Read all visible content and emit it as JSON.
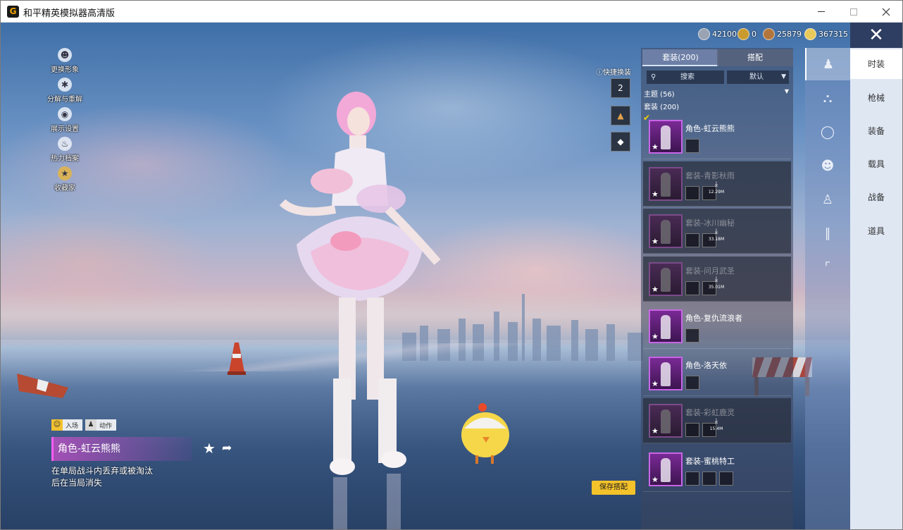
{
  "window": {
    "title": "和平精英模拟器高清版",
    "icon_letter": "G"
  },
  "currency": [
    {
      "icon": "silver-coin-icon",
      "value": "42100",
      "color": "#9aa3b3"
    },
    {
      "icon": "yellow-coupon-icon",
      "value": "0",
      "color": "#c99b2e"
    },
    {
      "icon": "bronze-coin-icon",
      "value": "25879",
      "color": "#b2763c"
    },
    {
      "icon": "gold-coin-icon",
      "value": "367315",
      "color": "#e8c95a"
    }
  ],
  "left_menu": [
    {
      "icon": "avatar-icon",
      "label": "更换形象"
    },
    {
      "icon": "puzzle-icon",
      "label": "分解与重解"
    },
    {
      "icon": "eye-icon",
      "label": "展示设置"
    },
    {
      "icon": "flame-icon",
      "label": "热力档案"
    },
    {
      "icon": "badge-icon",
      "label": "收藏家"
    }
  ],
  "quick_change": {
    "label": "快捷换装",
    "slot1_text": "2"
  },
  "save_button": "保存搭配",
  "selected": {
    "tag_entry": "入场",
    "tag_action": "动作",
    "name": "角色-虹云熊熊",
    "description": "在单局战斗内丢弃或被淘汰后在当局消失"
  },
  "list_panel": {
    "tab_outfits": "套装(200)",
    "tab_combo": "搭配",
    "search_placeholder": "搜索",
    "sort_label": "默认",
    "theme_label": "主题 (56)",
    "count_label": "套装 (200)",
    "items": [
      {
        "name": "角色-虹云熊熊",
        "owned": true,
        "size": ""
      },
      {
        "name": "套装-青影秋雨",
        "owned": false,
        "size": "12.29M"
      },
      {
        "name": "套装-冰川幽秘",
        "owned": false,
        "size": "33.18M"
      },
      {
        "name": "套装-问月武圣",
        "owned": false,
        "size": "35.01M"
      },
      {
        "name": "角色-复仇流浪者",
        "owned": true,
        "size": ""
      },
      {
        "name": "角色-洛天依",
        "owned": true,
        "size": ""
      },
      {
        "name": "套装-彩虹鹿灵",
        "owned": false,
        "size": "15.4M"
      },
      {
        "name": "套装-蜜桃特工",
        "owned": true,
        "size": ""
      }
    ]
  },
  "categories": [
    {
      "icon": "full-outfit-icon"
    },
    {
      "icon": "hat-icon"
    },
    {
      "icon": "goggles-icon"
    },
    {
      "icon": "mask-icon"
    },
    {
      "icon": "body-icon"
    },
    {
      "icon": "pants-icon"
    },
    {
      "icon": "shoes-icon"
    }
  ],
  "nav": [
    "时装",
    "枪械",
    "装备",
    "载具",
    "战备",
    "道具"
  ]
}
